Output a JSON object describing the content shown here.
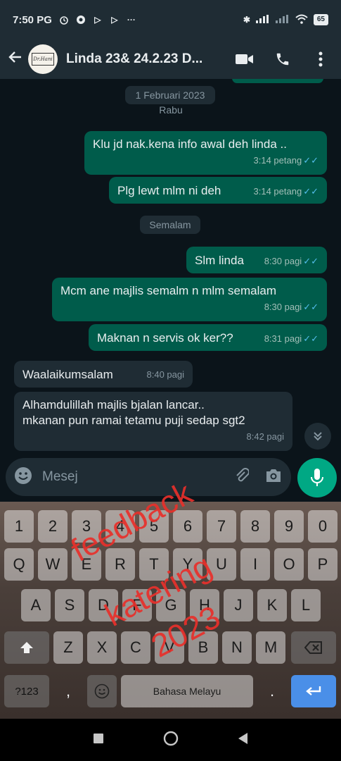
{
  "status_bar": {
    "time": "7:50 PG",
    "battery": "65"
  },
  "header": {
    "title": "Linda 23& 24.2.23 D...",
    "avatar_text": "Dr.Hani"
  },
  "chat": {
    "date_chip_1": "1 Februari 2023",
    "day_chip_1": "Rabu",
    "date_chip_2": "Semalam",
    "messages": [
      {
        "dir": "out",
        "text": "Klu jd nak.kena info awal deh linda ..",
        "time": "3:14 petang"
      },
      {
        "dir": "out",
        "text": "Plg lewt mlm ni deh",
        "time": "3:14 petang"
      },
      {
        "dir": "out",
        "text": "Slm linda",
        "time": "8:30 pagi"
      },
      {
        "dir": "out",
        "text": "Mcm ane majlis semalm n mlm semalam",
        "time": "8:30 pagi"
      },
      {
        "dir": "out",
        "text": "Maknan n servis ok ker??",
        "time": "8:31 pagi"
      },
      {
        "dir": "in",
        "text": "Waalaikumsalam",
        "time": "8:40 pagi"
      },
      {
        "dir": "in",
        "text_line1": "Alhamdulillah majlis bjalan lancar..",
        "text_line2": "mkanan pun ramai tetamu puji sedap sgt2",
        "time": "8:42 pagi"
      }
    ]
  },
  "composer": {
    "placeholder": "Mesej"
  },
  "keyboard": {
    "row1": [
      "1",
      "2",
      "3",
      "4",
      "5",
      "6",
      "7",
      "8",
      "9",
      "0"
    ],
    "row2": [
      "Q",
      "W",
      "E",
      "R",
      "T",
      "Y",
      "U",
      "I",
      "O",
      "P"
    ],
    "row3": [
      "A",
      "S",
      "D",
      "F",
      "G",
      "H",
      "J",
      "K",
      "L"
    ],
    "row4": [
      "Z",
      "X",
      "C",
      "V",
      "B",
      "N",
      "M"
    ],
    "symbols_key": "?123",
    "comma_key": ",",
    "space_label": "Bahasa Melayu",
    "period_key": "."
  },
  "overlay": {
    "line1": "feedback",
    "line2": "katering",
    "line3": "2023",
    "color": "#e8302b"
  },
  "colors": {
    "outgoing_bubble": "#005c4b",
    "incoming_bubble": "#1f2c34",
    "accent": "#00a884",
    "read_ticks": "#53bdeb"
  }
}
